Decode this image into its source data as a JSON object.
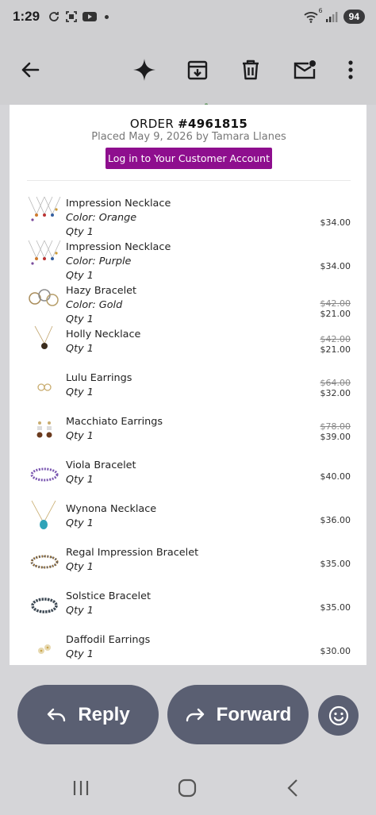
{
  "status": {
    "time": "1:29",
    "battery": "94",
    "wifi_badge": "6"
  },
  "toolbar": {
    "back": "arrow-left-icon",
    "gemini": "sparkle-icon",
    "archive": "archive-icon",
    "delete": "trash-icon",
    "mark_unread": "mail-unread-icon",
    "more": "more-vert-icon"
  },
  "order": {
    "prefix": "ORDER ",
    "number": "#4961815",
    "placed": "Placed May 9, 2026 by Tamara Llanes",
    "login_label": "Log in to Your Customer Account"
  },
  "items": [
    {
      "name": "Impression Necklace",
      "color": "Color: Orange",
      "qty": "Qty 1",
      "orig": "",
      "price": "$34.00",
      "thumb": "necklace-set"
    },
    {
      "name": "Impression Necklace",
      "color": "Color: Purple",
      "qty": "Qty 1",
      "orig": "",
      "price": "$34.00",
      "thumb": "necklace-set"
    },
    {
      "name": "Hazy Bracelet",
      "color": "Color: Gold",
      "qty": "Qty 1",
      "orig": "$42.00",
      "price": "$21.00",
      "thumb": "bracelet-gold"
    },
    {
      "name": "Holly Necklace",
      "color": "",
      "qty": "Qty 1",
      "orig": "$42.00",
      "price": "$21.00",
      "thumb": "pendant"
    },
    {
      "name": "Lulu Earrings",
      "color": "",
      "qty": "Qty 1",
      "orig": "$64.00",
      "price": "$32.00",
      "thumb": "hoops"
    },
    {
      "name": "Macchiato Earrings",
      "color": "",
      "qty": "Qty 1",
      "orig": "$78.00",
      "price": "$39.00",
      "thumb": "drops"
    },
    {
      "name": "Viola Bracelet",
      "color": "",
      "qty": "Qty 1",
      "orig": "",
      "price": "$40.00",
      "thumb": "bracelet-purple"
    },
    {
      "name": "Wynona Necklace",
      "color": "",
      "qty": "Qty 1",
      "orig": "",
      "price": "$36.00",
      "thumb": "turquoise"
    },
    {
      "name": "Regal Impression Bracelet",
      "color": "",
      "qty": "Qty 1",
      "orig": "",
      "price": "$35.00",
      "thumb": "bracelet-multi"
    },
    {
      "name": "Solstice Bracelet",
      "color": "",
      "qty": "Qty 1",
      "orig": "",
      "price": "$35.00",
      "thumb": "bracelet-dark"
    },
    {
      "name": "Daffodil Earrings",
      "color": "",
      "qty": "Qty 1",
      "orig": "",
      "price": "$30.00",
      "thumb": "flower-studs"
    }
  ],
  "actions": {
    "reply": "Reply",
    "forward": "Forward",
    "emoji": "smiley-icon"
  },
  "navbar": {
    "recents": "recents-icon",
    "home": "home-icon",
    "back": "back-chevron-icon"
  },
  "colors": {
    "accent": "#8e0e8e",
    "pill": "#5a5f72",
    "chrome": "#cfcfd1"
  }
}
